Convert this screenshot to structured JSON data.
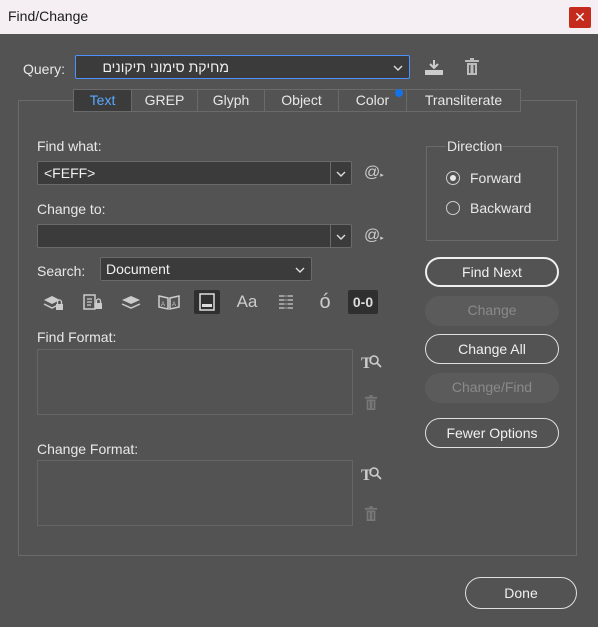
{
  "window": {
    "title": "Find/Change",
    "close_glyph": "✕"
  },
  "query": {
    "label": "Query:",
    "value": "מחיקת סימוני תיקונים",
    "save_icon": "save-query-icon",
    "delete_icon": "trash-icon"
  },
  "tabs": [
    {
      "label": "Text",
      "active": true
    },
    {
      "label": "GREP",
      "active": false
    },
    {
      "label": "Glyph",
      "active": false
    },
    {
      "label": "Object",
      "active": false
    },
    {
      "label": "Color",
      "active": false
    },
    {
      "label": "Transliterate",
      "active": false
    }
  ],
  "find_what": {
    "label": "Find what:",
    "value": "<FEFF>"
  },
  "change_to": {
    "label": "Change to:",
    "value": ""
  },
  "special_char_glyph": "@",
  "search": {
    "label": "Search:",
    "value": "Document"
  },
  "tools": [
    {
      "icon": "include-locked-layers-icon",
      "on": false
    },
    {
      "icon": "include-locked-stories-icon",
      "on": false
    },
    {
      "icon": "include-hidden-layers-icon",
      "on": false
    },
    {
      "icon": "include-master-pages-icon",
      "on": false
    },
    {
      "icon": "include-footnotes-icon",
      "on": true
    },
    {
      "icon": "case-sensitive-icon",
      "on": false,
      "glyph": "Aa"
    },
    {
      "icon": "whole-word-icon",
      "on": false
    },
    {
      "icon": "kana-sensitive-icon",
      "on": false,
      "glyph": "ó"
    },
    {
      "icon": "width-sensitive-icon",
      "on": true,
      "glyph": "0-0"
    }
  ],
  "find_format": {
    "label": "Find Format:"
  },
  "change_format": {
    "label": "Change Format:"
  },
  "direction": {
    "legend": "Direction",
    "options": [
      {
        "label": "Forward",
        "selected": true
      },
      {
        "label": "Backward",
        "selected": false
      }
    ]
  },
  "buttons": {
    "find_next": "Find Next",
    "change": "Change",
    "change_all": "Change All",
    "change_find": "Change/Find",
    "fewer_options": "Fewer Options",
    "done": "Done"
  },
  "colors": {
    "background": "#535353",
    "field": "#3b3b3b",
    "accent": "#4d90ff",
    "active_tab_text": "#5aa9ff",
    "close": "#c42b1c"
  }
}
